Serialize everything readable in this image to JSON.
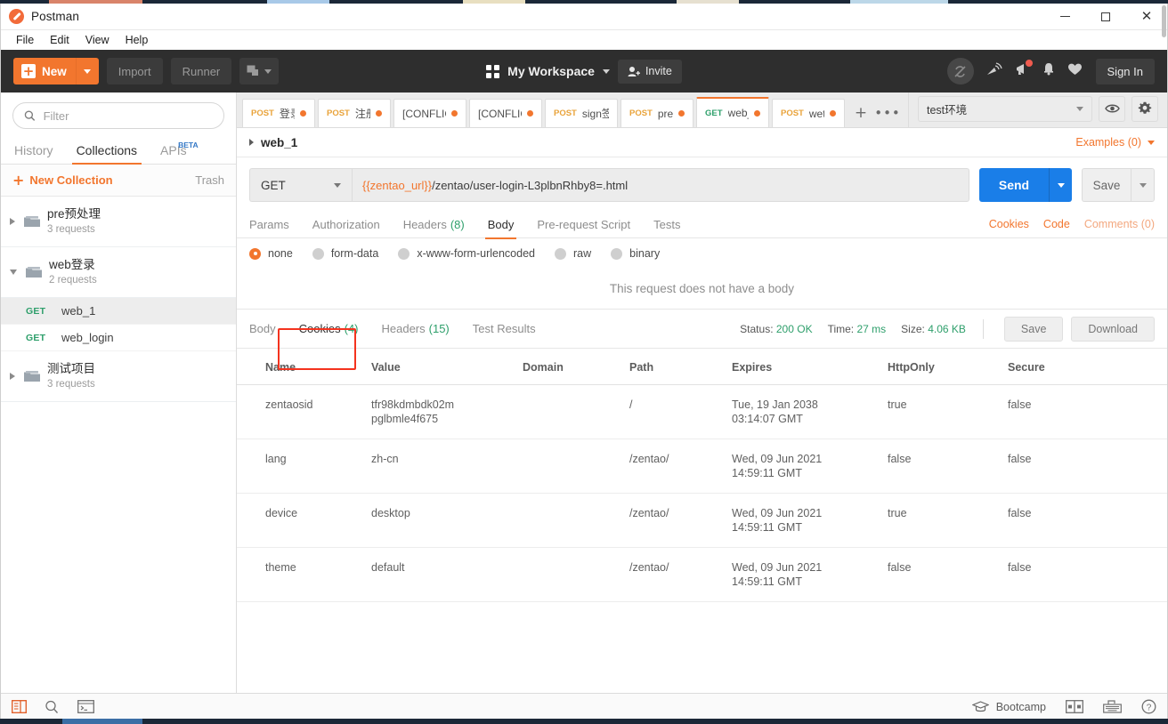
{
  "window": {
    "app_title": "Postman",
    "minimize_label": "Minimize",
    "maximize_label": "Maximize",
    "close_label": "Close"
  },
  "menubar": {
    "items": [
      "File",
      "Edit",
      "View",
      "Help"
    ]
  },
  "toolbar": {
    "new_label": "New",
    "import_label": "Import",
    "runner_label": "Runner",
    "workspace_name": "My Workspace",
    "invite_label": "Invite",
    "signin_label": "Sign In",
    "icons": [
      "sync-disabled-icon",
      "satellite-icon",
      "megaphone-icon",
      "bell-icon",
      "heart-icon"
    ]
  },
  "sidebar": {
    "filter_placeholder": "Filter",
    "filter_value": "",
    "tabs": [
      {
        "label": "History",
        "active": false
      },
      {
        "label": "Collections",
        "active": true
      },
      {
        "label": "APIs",
        "badge": "BETA",
        "active": false
      }
    ],
    "new_collection_label": "New Collection",
    "trash_label": "Trash",
    "collections": [
      {
        "name": "pre预处理",
        "count": "3 requests",
        "expanded": false,
        "requests": []
      },
      {
        "name": "web登录",
        "count": "2 requests",
        "expanded": true,
        "requests": [
          {
            "method": "GET",
            "name": "web_1",
            "selected": true
          },
          {
            "method": "GET",
            "name": "web_login",
            "selected": false
          }
        ]
      },
      {
        "name": "测试项目",
        "count": "3 requests",
        "expanded": false,
        "requests": []
      }
    ]
  },
  "request_tabs": {
    "items": [
      {
        "method": "POST",
        "title": "登录",
        "unsaved": true,
        "active": false
      },
      {
        "method": "POST",
        "title": "注册",
        "unsaved": true,
        "active": false
      },
      {
        "method": "",
        "title": "[CONFLIC",
        "unsaved": true,
        "active": false
      },
      {
        "method": "",
        "title": "[CONFLIC",
        "unsaved": true,
        "active": false
      },
      {
        "method": "POST",
        "title": "sign签名",
        "unsaved": false,
        "active": false
      },
      {
        "method": "POST",
        "title": "pre",
        "unsaved": true,
        "active": false
      },
      {
        "method": "GET",
        "title": "web_",
        "unsaved": true,
        "active": true
      },
      {
        "method": "POST",
        "title": "wet",
        "unsaved": true,
        "active": false
      }
    ],
    "add_label": "+",
    "more_label": "•••"
  },
  "environment": {
    "selected": "test环境",
    "eye_label": "Environment quick look",
    "gear_label": "Manage environments"
  },
  "request": {
    "name": "web_1",
    "examples_label": "Examples (0)",
    "method": "GET",
    "url_variable": "{{zentao_url}}",
    "url_rest": "/zentao/user-login-L3plbnRhby8=.html",
    "send_label": "Send",
    "save_label": "Save",
    "tabs": [
      {
        "label": "Params",
        "count": "",
        "active": false
      },
      {
        "label": "Authorization",
        "count": "",
        "active": false
      },
      {
        "label": "Headers",
        "count": "(8)",
        "active": false
      },
      {
        "label": "Body",
        "count": "",
        "active": true
      },
      {
        "label": "Pre-request Script",
        "count": "",
        "active": false
      },
      {
        "label": "Tests",
        "count": "",
        "active": false
      }
    ],
    "links": [
      {
        "label": "Cookies",
        "dim": false
      },
      {
        "label": "Code",
        "dim": false
      },
      {
        "label": "Comments (0)",
        "dim": true
      }
    ],
    "body_types": [
      {
        "label": "none",
        "selected": true
      },
      {
        "label": "form-data",
        "selected": false
      },
      {
        "label": "x-www-form-urlencoded",
        "selected": false
      },
      {
        "label": "raw",
        "selected": false
      },
      {
        "label": "binary",
        "selected": false
      }
    ],
    "no_body_text": "This request does not have a body"
  },
  "response": {
    "tabs": [
      {
        "label": "Body",
        "count": "",
        "active": false
      },
      {
        "label": "Cookies",
        "count": "(4)",
        "active": true,
        "highlighted": true
      },
      {
        "label": "Headers",
        "count": "(15)",
        "active": false
      },
      {
        "label": "Test Results",
        "count": "",
        "active": false
      }
    ],
    "status_label": "Status:",
    "status_value": "200 OK",
    "time_label": "Time:",
    "time_value": "27 ms",
    "size_label": "Size:",
    "size_value": "4.06 KB",
    "save_label": "Save",
    "download_label": "Download",
    "cookies_table": {
      "headers": [
        "Name",
        "Value",
        "Domain",
        "Path",
        "Expires",
        "HttpOnly",
        "Secure"
      ],
      "rows": [
        {
          "name": "zentaosid",
          "value": "tfr98kdmbdk02m\npglbmle4f675",
          "domain": "",
          "path": "/",
          "expires": "Tue, 19 Jan 2038\n03:14:07 GMT",
          "httponly": "true",
          "secure": "false"
        },
        {
          "name": "lang",
          "value": "zh-cn",
          "domain": "",
          "path": "/zentao/",
          "expires": "Wed, 09 Jun 2021\n14:59:11 GMT",
          "httponly": "false",
          "secure": "false"
        },
        {
          "name": "device",
          "value": "desktop",
          "domain": "",
          "path": "/zentao/",
          "expires": "Wed, 09 Jun 2021\n14:59:11 GMT",
          "httponly": "true",
          "secure": "false"
        },
        {
          "name": "theme",
          "value": "default",
          "domain": "",
          "path": "/zentao/",
          "expires": "Wed, 09 Jun 2021\n14:59:11 GMT",
          "httponly": "false",
          "secure": "false"
        }
      ]
    }
  },
  "statusbar": {
    "left_icons": [
      "sidebar-toggle-icon",
      "find-icon",
      "console-icon"
    ],
    "bootcamp_label": "Bootcamp",
    "right_icons": [
      "two-pane-layout-icon",
      "keyboard-shortcuts-icon",
      "help-icon"
    ]
  },
  "colors": {
    "accent": "#f2762e",
    "send": "#1a7ee8",
    "success": "#2e9f6b",
    "highlight": "#f4331e",
    "toolbar_bg": "#2e2e2e"
  }
}
